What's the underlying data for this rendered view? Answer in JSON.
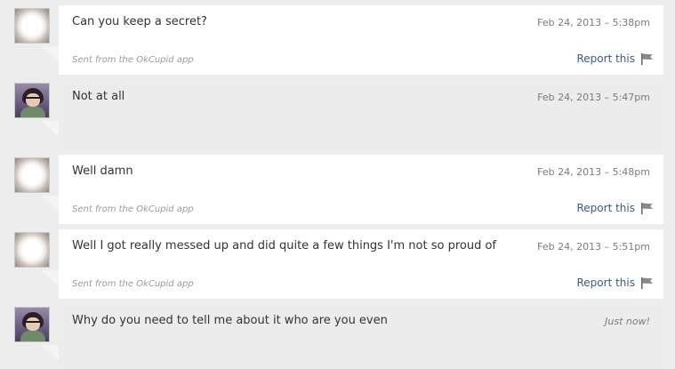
{
  "messages": [
    {
      "text": "Can you keep a secret?",
      "time": "Feb 24, 2013 – 5:38pm",
      "sent_from": "Sent from the OkCupid app",
      "report_label": "Report this"
    },
    {
      "text": "Not at all",
      "time": "Feb 24, 2013 – 5:47pm"
    },
    {
      "text": "Well damn",
      "time": "Feb 24, 2013 – 5:48pm",
      "sent_from": "Sent from the OkCupid app",
      "report_label": "Report this"
    },
    {
      "text": "Well I got really messed up and did quite a few things I'm not so proud of",
      "time": "Feb 24, 2013 – 5:51pm",
      "sent_from": "Sent from the OkCupid app",
      "report_label": "Report this"
    },
    {
      "text": "Why do you need to tell me about it who are you even",
      "time": "Just now!"
    }
  ],
  "icons": {
    "report": "flag-icon",
    "other_avatar": "glowing-avatar",
    "own_avatar": "profile-photo-avatar"
  },
  "colors": {
    "incoming_bubble": "#ffffff",
    "outgoing_bubble": "#ececec",
    "link": "#3c5a8a",
    "background": "#ededed"
  }
}
